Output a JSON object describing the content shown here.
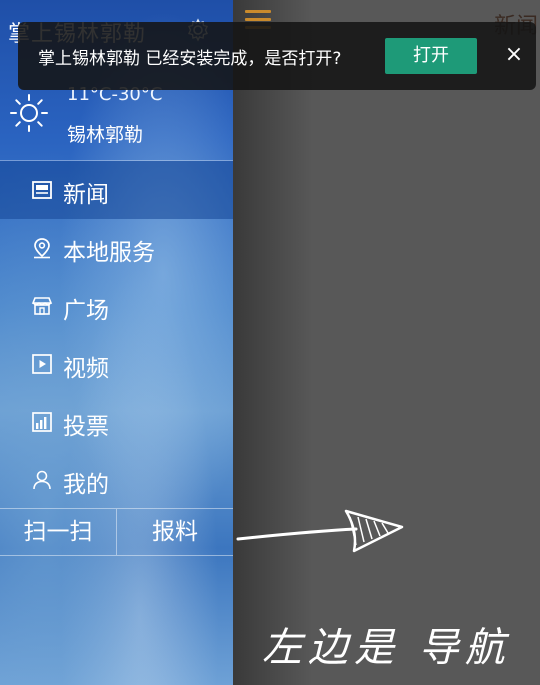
{
  "app": {
    "title": "掌上锡林郭勒",
    "settings_icon": "gear-icon"
  },
  "right_pane": {
    "menu_icon": "hamburger-icon",
    "title": "新闻"
  },
  "weather": {
    "icon": "sun-icon",
    "temperature": "11°C-30°C",
    "city": "锡林郭勒"
  },
  "menu": {
    "items": [
      {
        "label": "新闻",
        "icon": "news-icon",
        "active": true
      },
      {
        "label": "本地服务",
        "icon": "location-pin-icon",
        "active": false
      },
      {
        "label": "广场",
        "icon": "store-icon",
        "active": false
      },
      {
        "label": "视频",
        "icon": "play-icon",
        "active": false
      },
      {
        "label": "投票",
        "icon": "bar-chart-icon",
        "active": false
      },
      {
        "label": "我的",
        "icon": "user-icon",
        "active": false
      }
    ]
  },
  "bottom_bar": {
    "scan_label": "扫一扫",
    "report_label": "报料"
  },
  "toast": {
    "message": "掌上锡林郭勒 已经安装完成，是否打开?",
    "open_label": "打开",
    "close_label": "×",
    "open_color": "#1e9a78"
  },
  "annotation": {
    "text": "左边是 导航"
  }
}
